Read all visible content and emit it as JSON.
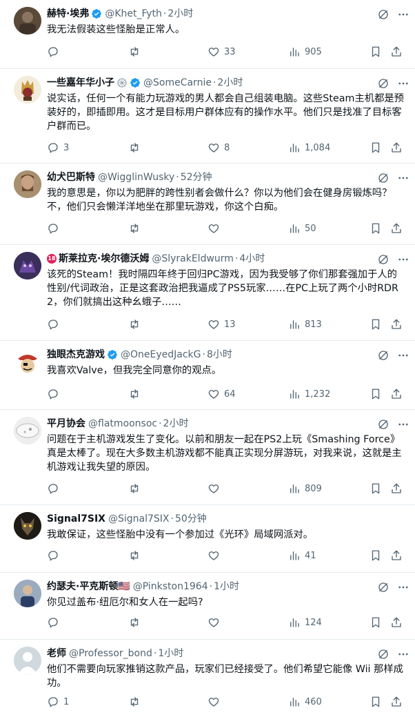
{
  "tweets": [
    {
      "name": "赫特·埃弗",
      "verified": true,
      "handle": "@Khet_Fyth",
      "time": "2小时",
      "text": "我无法假装这些怪胎是正常人。",
      "replies": "",
      "retweets": "",
      "likes": "33",
      "views": "905",
      "avatar_color": "#6b5a48"
    },
    {
      "name": "一些嘉年华小子",
      "verified": true,
      "handle": "@SomeCarnie",
      "time": "2小时",
      "text": "说实话，任何一个有能力玩游戏的男人都会自己组装电脑。这些Steam主机都是预装好的，即插即用。这才是目标用户群体应有的操作水平。他们只是找准了目标客户群而已。",
      "replies": "3",
      "retweets": "",
      "likes": "8",
      "views": "1,084",
      "avatar_color": "#c89b3c"
    },
    {
      "name": "幼犬巴斯特",
      "verified": false,
      "handle": "@WigglinWusky",
      "time": "52分钟",
      "text": "我的意思是，你以为肥胖的跨性别者会做什么？你以为他们会在健身房锻炼吗？不，他们只会懒洋洋地坐在那里玩游戏，你这个白痴。",
      "replies": "",
      "retweets": "",
      "likes": "",
      "views": "50",
      "avatar_color": "#7a6150"
    },
    {
      "name": "斯莱拉克·埃尔德沃姆",
      "verified": false,
      "handle": "@SlyrakEldwurm",
      "time": "4小时",
      "text": "该死的Steam！我时隔四年终于回归PC游戏，因为我受够了你们那套强加于人的性别/代词政治，正是这套政治把我逼成了PS5玩家……在PC上玩了两个小时RDR2，你们就搞出这种幺蛾子……",
      "replies": "",
      "retweets": "",
      "likes": "13",
      "views": "813",
      "avatar_color": "#4a3a6e"
    },
    {
      "name": "独眼杰克游戏",
      "verified": true,
      "handle": "@OneEyedJackG",
      "time": "8小时",
      "text": "我喜欢Valve，但我完全同意你的观点。",
      "replies": "",
      "retweets": "",
      "likes": "64",
      "views": "1,232",
      "avatar_color": "#f0f0f0"
    },
    {
      "name": "平月协会",
      "verified": false,
      "handle": "@flatmoonsoc",
      "time": "2小时",
      "text": "问题在于主机游戏发生了变化。以前和朋友一起在PS2上玩《Smashing Force》真是太棒了。现在大多数主机游戏都不能真正实现分屏游玩，对我来说，这就是主机游戏让我失望的原因。",
      "replies": "",
      "retweets": "",
      "likes": "",
      "views": "809",
      "avatar_color": "#dcdcdc"
    },
    {
      "name": "Signal7SIX",
      "verified": false,
      "handle": "@Signal7SIX",
      "time": "50分钟",
      "text": "我敢保证，这些怪胎中没有一个参加过《光环》局域网派对。",
      "replies": "",
      "retweets": "",
      "likes": "",
      "views": "41",
      "avatar_color": "#2a2420"
    },
    {
      "name": "约瑟夫·平克斯顿🇺🇸",
      "verified": false,
      "handle": "@Pinkston1964",
      "time": "1小时",
      "text": "你见过盖布·纽厄尔和女人在一起吗?",
      "replies": "",
      "retweets": "",
      "likes": "",
      "views": "124",
      "avatar_color": "#8a9bb0"
    },
    {
      "name": "老师",
      "verified": false,
      "handle": "@Professor_bond",
      "time": "1小时",
      "text": "他们不需要向玩家推销这款产品，玩家们已经接受了。他们希望它能像 Wii 那样成功。",
      "replies": "1",
      "retweets": "",
      "likes": "",
      "views": "460",
      "avatar_color": "#cfd9de"
    }
  ],
  "icons": {
    "reply": "reply-icon",
    "retweet": "retweet-icon",
    "like": "like-icon",
    "views": "views-icon",
    "bookmark": "bookmark-icon",
    "share": "share-icon",
    "grok": "grok-icon",
    "more": "more-icon"
  },
  "colors": {
    "verified": "#1d9bf0",
    "secondary_text": "#536471",
    "divider": "#e6ebef"
  }
}
